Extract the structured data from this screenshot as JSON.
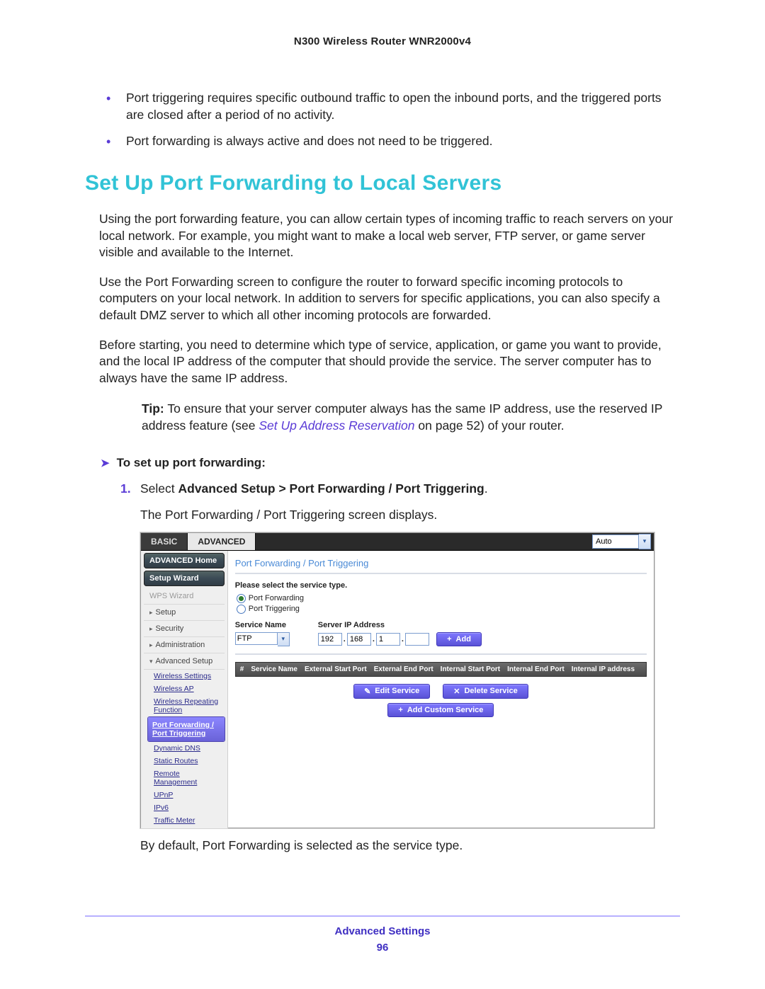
{
  "header": {
    "product": "N300 Wireless Router WNR2000v4"
  },
  "bullets": [
    "Port triggering requires specific outbound traffic to open the inbound ports, and the triggered ports are closed after a period of no activity.",
    "Port forwarding is always active and does not need to be triggered."
  ],
  "section_title": "Set Up Port Forwarding to Local Servers",
  "paragraphs": [
    "Using the port forwarding feature, you can allow certain types of incoming traffic to reach servers on your local network. For example, you might want to make a local web server, FTP server, or game server visible and available to the Internet.",
    "Use the Port Forwarding screen to configure the router to forward specific incoming protocols to computers on your local network. In addition to servers for specific applications, you can also specify a default DMZ server to which all other incoming protocols are forwarded.",
    "Before starting, you need to determine which type of service, application, or game you want to provide, and the local IP address of the computer that should provide the service. The server computer has to always have the same IP address."
  ],
  "tip": {
    "label": "Tip:",
    "pre": "To ensure that your server computer always has the same IP address, use the reserved IP address feature (see ",
    "link": "Set Up Address Reservation",
    "post": " on page 52) of your router."
  },
  "procedure_title": "To set up port forwarding:",
  "step1": {
    "num": "1.",
    "pre": "Select ",
    "bold": "Advanced Setup > Port Forwarding / Port Triggering",
    "post": ".",
    "sub": "The Port Forwarding / Port Triggering screen displays."
  },
  "after_shot": "By default, Port Forwarding is selected as the service type.",
  "footer": {
    "section": "Advanced Settings",
    "page": "96"
  },
  "ui": {
    "tabs": {
      "basic": "BASIC",
      "advanced": "ADVANCED"
    },
    "auto_value": "Auto",
    "sidebar": {
      "items": [
        {
          "label": "ADVANCED Home",
          "type": "pill"
        },
        {
          "label": "Setup Wizard",
          "type": "pill"
        },
        {
          "label": "WPS Wizard",
          "type": "row-disabled"
        },
        {
          "label": "Setup",
          "type": "row-tri"
        },
        {
          "label": "Security",
          "type": "row-tri"
        },
        {
          "label": "Administration",
          "type": "row-tri"
        },
        {
          "label": "Advanced Setup",
          "type": "row-tri-open"
        }
      ],
      "subs": [
        "Wireless Settings",
        "Wireless AP",
        "Wireless Repeating Function",
        "Port Forwarding / Port Triggering",
        "Dynamic DNS",
        "Static Routes",
        "Remote Management",
        "UPnP",
        "IPv6",
        "Traffic Meter"
      ],
      "selected_sub_index": 3
    },
    "main": {
      "crumb": "Port Forwarding / Port Triggering",
      "select_label": "Please select the service type.",
      "radio1": "Port Forwarding",
      "radio2": "Port Triggering",
      "service_name_label": "Service Name",
      "server_ip_label": "Server IP Address",
      "service_value": "FTP",
      "ip": [
        "192",
        "168",
        "1",
        ""
      ],
      "add_btn": "Add",
      "thead": [
        "#",
        "Service Name",
        "External Start Port",
        "External End Port",
        "Internal Start Port",
        "Internal End Port",
        "Internal IP address"
      ],
      "edit_btn": "Edit Service",
      "delete_btn": "Delete Service",
      "custom_btn": "Add Custom Service"
    }
  }
}
